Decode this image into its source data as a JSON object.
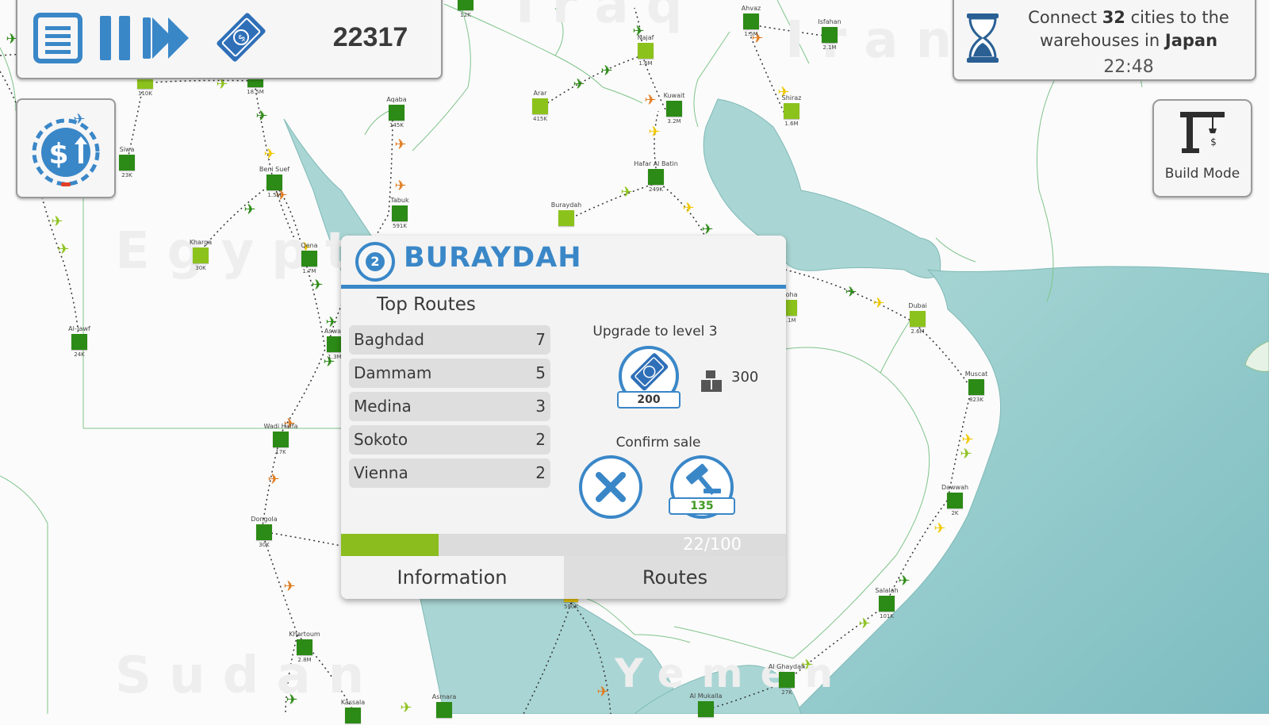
{
  "hud": {
    "score": "22317",
    "icons": [
      "menu-icon",
      "pause-icon",
      "fast-forward-icon",
      "money-icon",
      "finance-upgrade-icon",
      "hourglass-icon",
      "crane-icon"
    ]
  },
  "objective": {
    "line1_prefix": "Connect ",
    "count": "32",
    "line1_suffix": " cities to the",
    "line2_prefix": "warehouses in ",
    "country": "Japan",
    "timer": "22:48"
  },
  "build_mode": {
    "label": "Build Mode"
  },
  "map": {
    "country_labels": [
      {
        "name": "Egypt",
        "text": "Egypt"
      },
      {
        "name": "Sudan",
        "text": "Sudan"
      },
      {
        "name": "Yemen",
        "text": "Yemen"
      },
      {
        "name": "Iran",
        "text": "Iran"
      },
      {
        "name": "Iraq",
        "text": "Iraq"
      }
    ],
    "cities": [
      {
        "name": "",
        "pop": "12K"
      },
      {
        "name": "Ahvaz",
        "pop": "1.5M"
      },
      {
        "name": "Isfahan",
        "pop": "2.1M"
      },
      {
        "name": "Najaf",
        "pop": "1.6M"
      },
      {
        "name": "",
        "pop": "110K"
      },
      {
        "name": "",
        "pop": "18.5M"
      },
      {
        "name": "Aqaba",
        "pop": "145K"
      },
      {
        "name": "Arar",
        "pop": "415K"
      },
      {
        "name": "Kuwait",
        "pop": "3.2M"
      },
      {
        "name": "Shiraz",
        "pop": "1.6M"
      },
      {
        "name": "Siwa",
        "pop": "23K"
      },
      {
        "name": "Beni Suef",
        "pop": "1.5M"
      },
      {
        "name": "Tabuk",
        "pop": "591K"
      },
      {
        "name": "Hafar Al Batin",
        "pop": "249K"
      },
      {
        "name": "Buraydah",
        "pop": ""
      },
      {
        "name": "Kharga",
        "pop": "30K"
      },
      {
        "name": "Qena",
        "pop": "1.7M"
      },
      {
        "name": "Al-Jawf",
        "pop": "24K"
      },
      {
        "name": "Aswan",
        "pop": "1.3M"
      },
      {
        "name": "Doha",
        "pop": "1.1M"
      },
      {
        "name": "Dubai",
        "pop": "2.6M"
      },
      {
        "name": "Muscat",
        "pop": "823K"
      },
      {
        "name": "Wadi Halfa",
        "pop": "17K"
      },
      {
        "name": "Dawwah",
        "pop": "2K"
      },
      {
        "name": "Dongola",
        "pop": "30K"
      },
      {
        "name": "",
        "pop": "590K"
      },
      {
        "name": "Salalah",
        "pop": "101K"
      },
      {
        "name": "Khartoum",
        "pop": "2.8M"
      },
      {
        "name": "Al Ghaydah",
        "pop": "27K"
      },
      {
        "name": "Al Mukalla",
        "pop": ""
      },
      {
        "name": "Kassala",
        "pop": ""
      },
      {
        "name": "Asmara",
        "pop": ""
      }
    ]
  },
  "popup": {
    "level": "2",
    "city": "BURAYDAH",
    "top_routes_title": "Top Routes",
    "routes": [
      {
        "city": "Baghdad",
        "count": "7"
      },
      {
        "city": "Dammam",
        "count": "5"
      },
      {
        "city": "Medina",
        "count": "3"
      },
      {
        "city": "Sokoto",
        "count": "2"
      },
      {
        "city": "Vienna",
        "count": "2"
      }
    ],
    "upgrade_title": "Upgrade to level 3",
    "upgrade_cost": "200",
    "upgrade_cargo": "300",
    "confirm_title": "Confirm sale",
    "sale_value": "135",
    "progress_text": "22/100",
    "progress_fraction": 0.22,
    "tabs": [
      "Information",
      "Routes"
    ]
  },
  "colors": {
    "accent_blue": "#3a87c8",
    "water": "#a9d6d4",
    "city_dark": "#2c8a16",
    "city_light": "#8cc21c",
    "progress_fill": "#8bbd1e"
  }
}
